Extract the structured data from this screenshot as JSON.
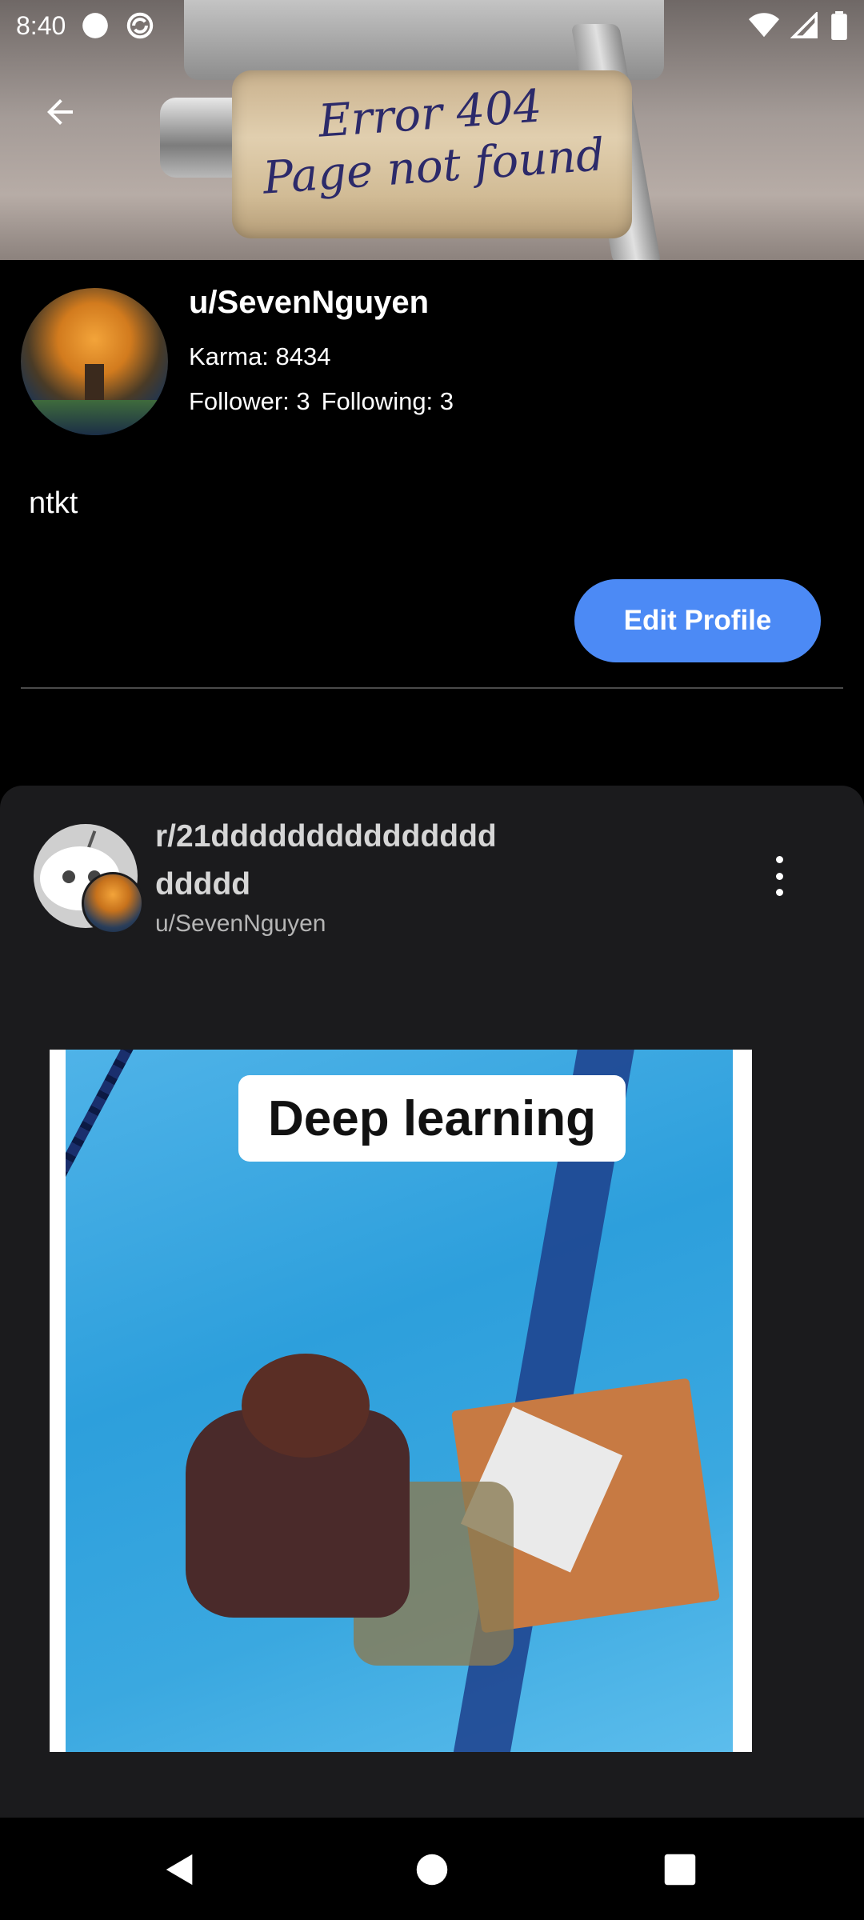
{
  "status_bar": {
    "time": "8:40"
  },
  "banner": {
    "line1": "Error 404",
    "line2": "Page not found"
  },
  "profile": {
    "username": "u/SevenNguyen",
    "karma": "Karma: 8434",
    "followers": "Follower: 3",
    "following": "Following: 3",
    "bio": "ntkt",
    "edit_button": "Edit Profile"
  },
  "post": {
    "subreddit": "r/21dddddddddddddddddddd",
    "author": "u/SevenNguyen",
    "image_caption": "Deep learning"
  },
  "colors": {
    "accent": "#4c8af5",
    "background": "#000000",
    "card": "#1b1b1d"
  },
  "icons": {
    "back": "arrow-left-icon",
    "more": "more-vertical-icon",
    "nav_back": "nav-back-icon",
    "nav_home": "nav-home-icon",
    "nav_recents": "nav-recents-icon"
  }
}
